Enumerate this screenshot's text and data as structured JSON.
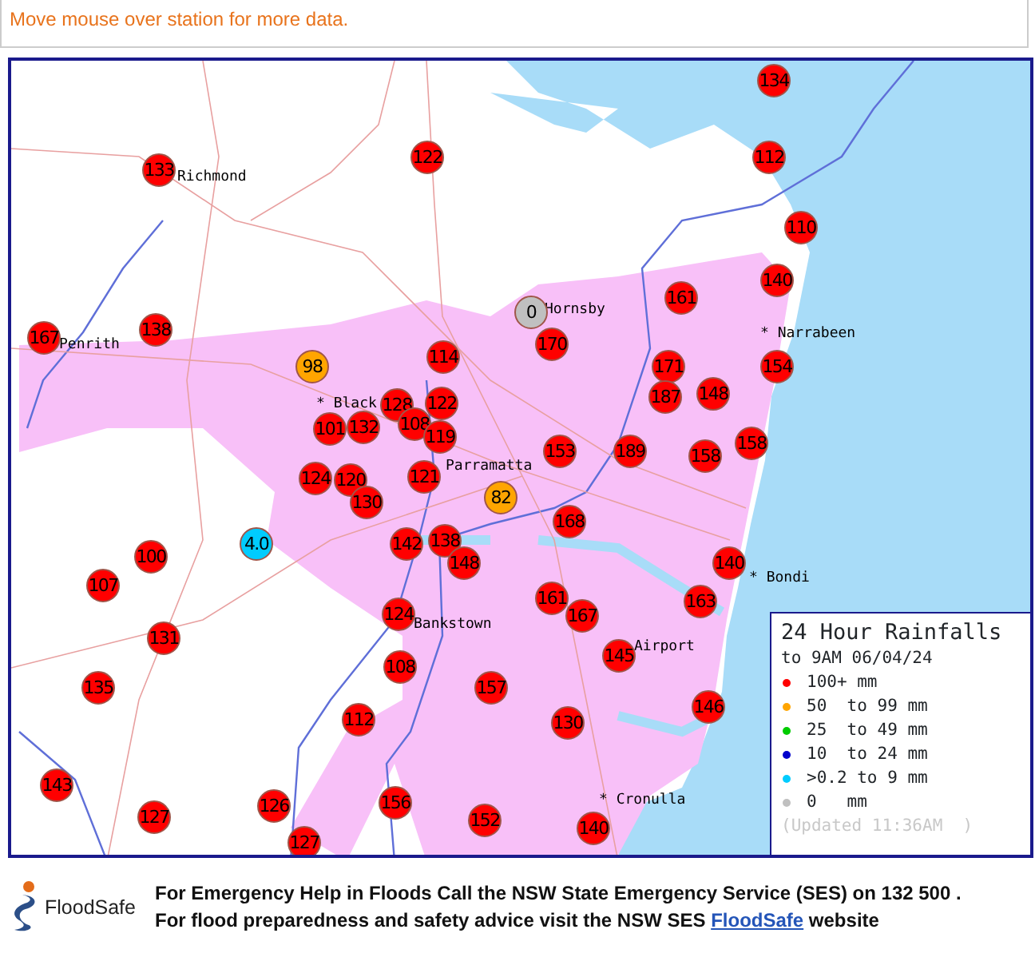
{
  "instruction": "Move mouse over station for more data.",
  "map": {
    "places": [
      {
        "text": "Richmond"
      },
      {
        "text": "Penrith"
      },
      {
        "text": "Hornsby"
      },
      {
        "text": "* Narrabeen"
      },
      {
        "text": "* Black"
      },
      {
        "text": "Parramatta"
      },
      {
        "text": "* Bondi"
      },
      {
        "text": "Bankstown"
      },
      {
        "text": "Airport"
      },
      {
        "text": "* Cronulla"
      }
    ],
    "stations": [
      {
        "value": "134",
        "color": "#ff0000"
      },
      {
        "value": "112",
        "color": "#ff0000"
      },
      {
        "value": "110",
        "color": "#ff0000"
      },
      {
        "value": "140",
        "color": "#ff0000"
      },
      {
        "value": "161",
        "color": "#ff0000"
      },
      {
        "value": "0",
        "color": "#c0c0c0"
      },
      {
        "value": "133",
        "color": "#ff0000"
      },
      {
        "value": "122",
        "color": "#ff0000"
      },
      {
        "value": "167",
        "color": "#ff0000"
      },
      {
        "value": "138",
        "color": "#ff0000"
      },
      {
        "value": "98",
        "color": "#ffa500"
      },
      {
        "value": "114",
        "color": "#ff0000"
      },
      {
        "value": "170",
        "color": "#ff0000"
      },
      {
        "value": "171",
        "color": "#ff0000"
      },
      {
        "value": "154",
        "color": "#ff0000"
      },
      {
        "value": "187",
        "color": "#ff0000"
      },
      {
        "value": "148",
        "color": "#ff0000"
      },
      {
        "value": "128",
        "color": "#ff0000"
      },
      {
        "value": "122",
        "color": "#ff0000"
      },
      {
        "value": "101",
        "color": "#ff0000"
      },
      {
        "value": "132",
        "color": "#ff0000"
      },
      {
        "value": "108",
        "color": "#ff0000"
      },
      {
        "value": "119",
        "color": "#ff0000"
      },
      {
        "value": "153",
        "color": "#ff0000"
      },
      {
        "value": "189",
        "color": "#ff0000"
      },
      {
        "value": "158",
        "color": "#ff0000"
      },
      {
        "value": "158",
        "color": "#ff0000"
      },
      {
        "value": "121",
        "color": "#ff0000"
      },
      {
        "value": "82",
        "color": "#ffa500"
      },
      {
        "value": "124",
        "color": "#ff0000"
      },
      {
        "value": "120",
        "color": "#ff0000"
      },
      {
        "value": "130",
        "color": "#ff0000"
      },
      {
        "value": "168",
        "color": "#ff0000"
      },
      {
        "value": "4.0",
        "color": "#00ccff"
      },
      {
        "value": "142",
        "color": "#ff0000"
      },
      {
        "value": "138",
        "color": "#ff0000"
      },
      {
        "value": "148",
        "color": "#ff0000"
      },
      {
        "value": "140",
        "color": "#ff0000"
      },
      {
        "value": "100",
        "color": "#ff0000"
      },
      {
        "value": "107",
        "color": "#ff0000"
      },
      {
        "value": "161",
        "color": "#ff0000"
      },
      {
        "value": "167",
        "color": "#ff0000"
      },
      {
        "value": "163",
        "color": "#ff0000"
      },
      {
        "value": "131",
        "color": "#ff0000"
      },
      {
        "value": "124",
        "color": "#ff0000"
      },
      {
        "value": "145",
        "color": "#ff0000"
      },
      {
        "value": "135",
        "color": "#ff0000"
      },
      {
        "value": "108",
        "color": "#ff0000"
      },
      {
        "value": "157",
        "color": "#ff0000"
      },
      {
        "value": "146",
        "color": "#ff0000"
      },
      {
        "value": "112",
        "color": "#ff0000"
      },
      {
        "value": "130",
        "color": "#ff0000"
      },
      {
        "value": "143",
        "color": "#ff0000"
      },
      {
        "value": "127",
        "color": "#ff0000"
      },
      {
        "value": "126",
        "color": "#ff0000"
      },
      {
        "value": "156",
        "color": "#ff0000"
      },
      {
        "value": "152",
        "color": "#ff0000"
      },
      {
        "value": "140",
        "color": "#ff0000"
      },
      {
        "value": "127",
        "color": "#ff0000"
      }
    ]
  },
  "legend": {
    "title": "24 Hour Rainfalls",
    "subtitle": "to 9AM 06/04/24",
    "items": [
      {
        "label": "100+ mm",
        "color": "#ff0000"
      },
      {
        "label": "50  to 99 mm",
        "color": "#ffa500"
      },
      {
        "label": "25  to 49 mm",
        "color": "#00cc00"
      },
      {
        "label": "10  to 24 mm",
        "color": "#0000cc"
      },
      {
        "label": ">0.2 to 9 mm",
        "color": "#00ccff"
      },
      {
        "label": "0   mm",
        "color": "#c0c0c0"
      }
    ],
    "updated": "(Updated 11:36AM  )"
  },
  "footer": {
    "logo_text": "FloodSafe",
    "line1": "For Emergency Help in Floods Call the NSW State Emergency Service (SES) on 132 500 .",
    "line2_before": "For flood preparedness and safety advice visit the NSW SES ",
    "line2_link": "FloodSafe",
    "line2_after": " website"
  }
}
